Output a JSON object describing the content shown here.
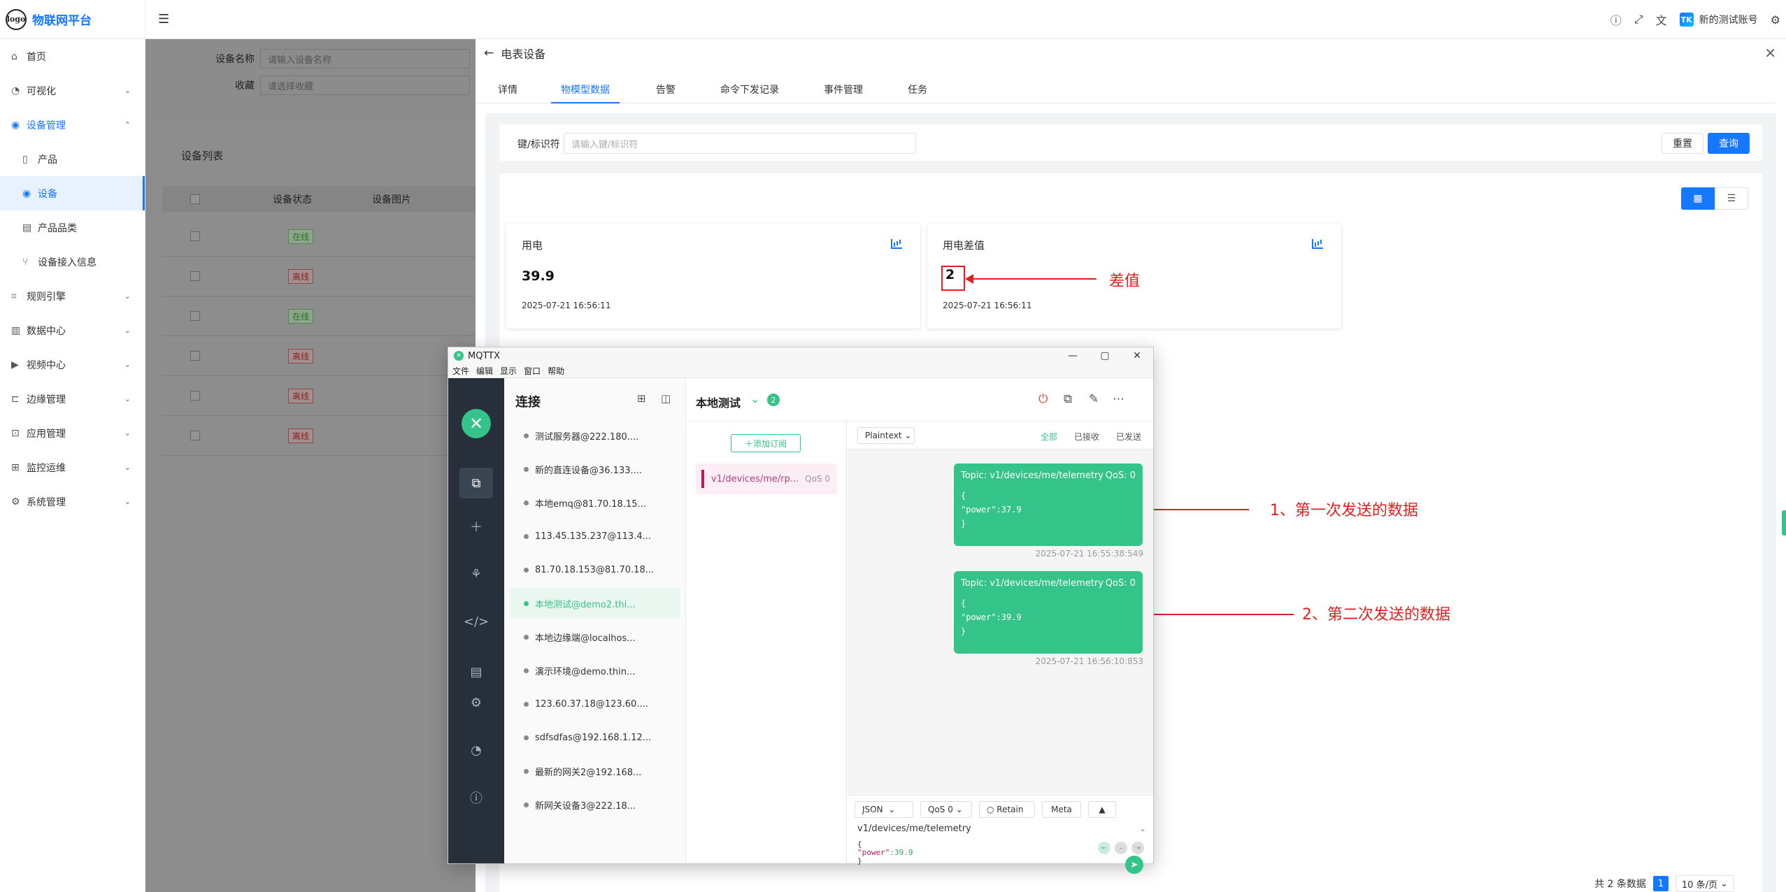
{
  "header": {
    "logo_text": "logo",
    "app_title": "物联网平台",
    "account_name": "新的测试账号",
    "brand_mark": "TK"
  },
  "sidebar": {
    "items": [
      {
        "label": "首页"
      },
      {
        "label": "可视化"
      },
      {
        "label": "设备管理"
      },
      {
        "label": "产品"
      },
      {
        "label": "设备"
      },
      {
        "label": "产品品类"
      },
      {
        "label": "设备接入信息"
      },
      {
        "label": "规则引擎"
      },
      {
        "label": "数据中心"
      },
      {
        "label": "视频中心"
      },
      {
        "label": "边缘管理"
      },
      {
        "label": "应用管理"
      },
      {
        "label": "监控运维"
      },
      {
        "label": "系统管理"
      }
    ]
  },
  "background_page": {
    "filter_device_name_label": "设备名称",
    "filter_device_name_placeholder": "请输入设备名称",
    "filter_fav_label": "收藏",
    "filter_fav_placeholder": "请选择收藏",
    "list_title": "设备列表",
    "col_status": "设备状态",
    "col_image": "设备图片",
    "rows": [
      "在线",
      "离线",
      "在线",
      "离线",
      "离线",
      "离线"
    ]
  },
  "drawer": {
    "title": "电表设备",
    "tabs": [
      "详情",
      "物模型数据",
      "告警",
      "命令下发记录",
      "事件管理",
      "任务"
    ],
    "search_label": "键/标识符",
    "search_placeholder": "请输入键/标识符",
    "reset_label": "重置",
    "query_label": "查询",
    "metrics": [
      {
        "title": "用电",
        "value": "39.9",
        "time": "2025-07-21 16:56:11"
      },
      {
        "title": "用电差值",
        "value": "2",
        "time": "2025-07-21 16:56:11"
      }
    ],
    "annotation_diff": "差值",
    "pager_total": "共 2 条数据",
    "pager_page": "1",
    "pager_size": "10 条/页"
  },
  "mqttx": {
    "window_title": "MQTTX",
    "menus": [
      "文件",
      "编辑",
      "显示",
      "窗口",
      "帮助"
    ],
    "connections_title": "连接",
    "connections": [
      "测试服务器@222.180....",
      "新的直连设备@36.133....",
      "本地emq@81.70.18.15...",
      "113.45.135.237@113.4...",
      "81.70.18.153@81.70.18...",
      "本地测试@demo2.thi...",
      "本地边缘端@localhos...",
      "演示环境@demo.thin...",
      "123.60.37.18@123.60....",
      "sdfsdfas@192.168.1.12...",
      "最新的网关2@192.168...",
      "新网关设备3@222.18..."
    ],
    "active_connection_index": 5,
    "current_connection": "本地测试",
    "subscription_count": "2",
    "add_subscription_label": "添加订阅",
    "subscription": {
      "topic": "v1/devices/me/rp...",
      "qos": "QoS 0"
    },
    "payload_format": "Plaintext",
    "filters": [
      "全部",
      "已接收",
      "已发送"
    ],
    "messages": [
      {
        "topic": "Topic: v1/devices/me/telemetry",
        "qos": "QoS: 0",
        "body": "{\n\"power\":37.9\n}",
        "time": "2025-07-21 16:55:38:549"
      },
      {
        "topic": "Topic: v1/devices/me/telemetry",
        "qos": "QoS: 0",
        "body": "{\n\"power\":39.9\n}",
        "time": "2025-07-21 16:56:10:853"
      }
    ],
    "compose": {
      "format": "JSON",
      "qos": "QoS 0",
      "retain": "Retain",
      "meta": "Meta",
      "topic": "v1/devices/me/telemetry",
      "payload_open": "{",
      "payload_key": "\"power\"",
      "payload_value": ":39.9",
      "payload_close": "}"
    }
  },
  "annotations": {
    "first_send": "1、第一次发送的数据",
    "second_send": "2、第二次发送的数据"
  },
  "colors": {
    "primary": "#1677ff",
    "mqttx_green": "#34c388",
    "annotation_red": "#e02020"
  }
}
